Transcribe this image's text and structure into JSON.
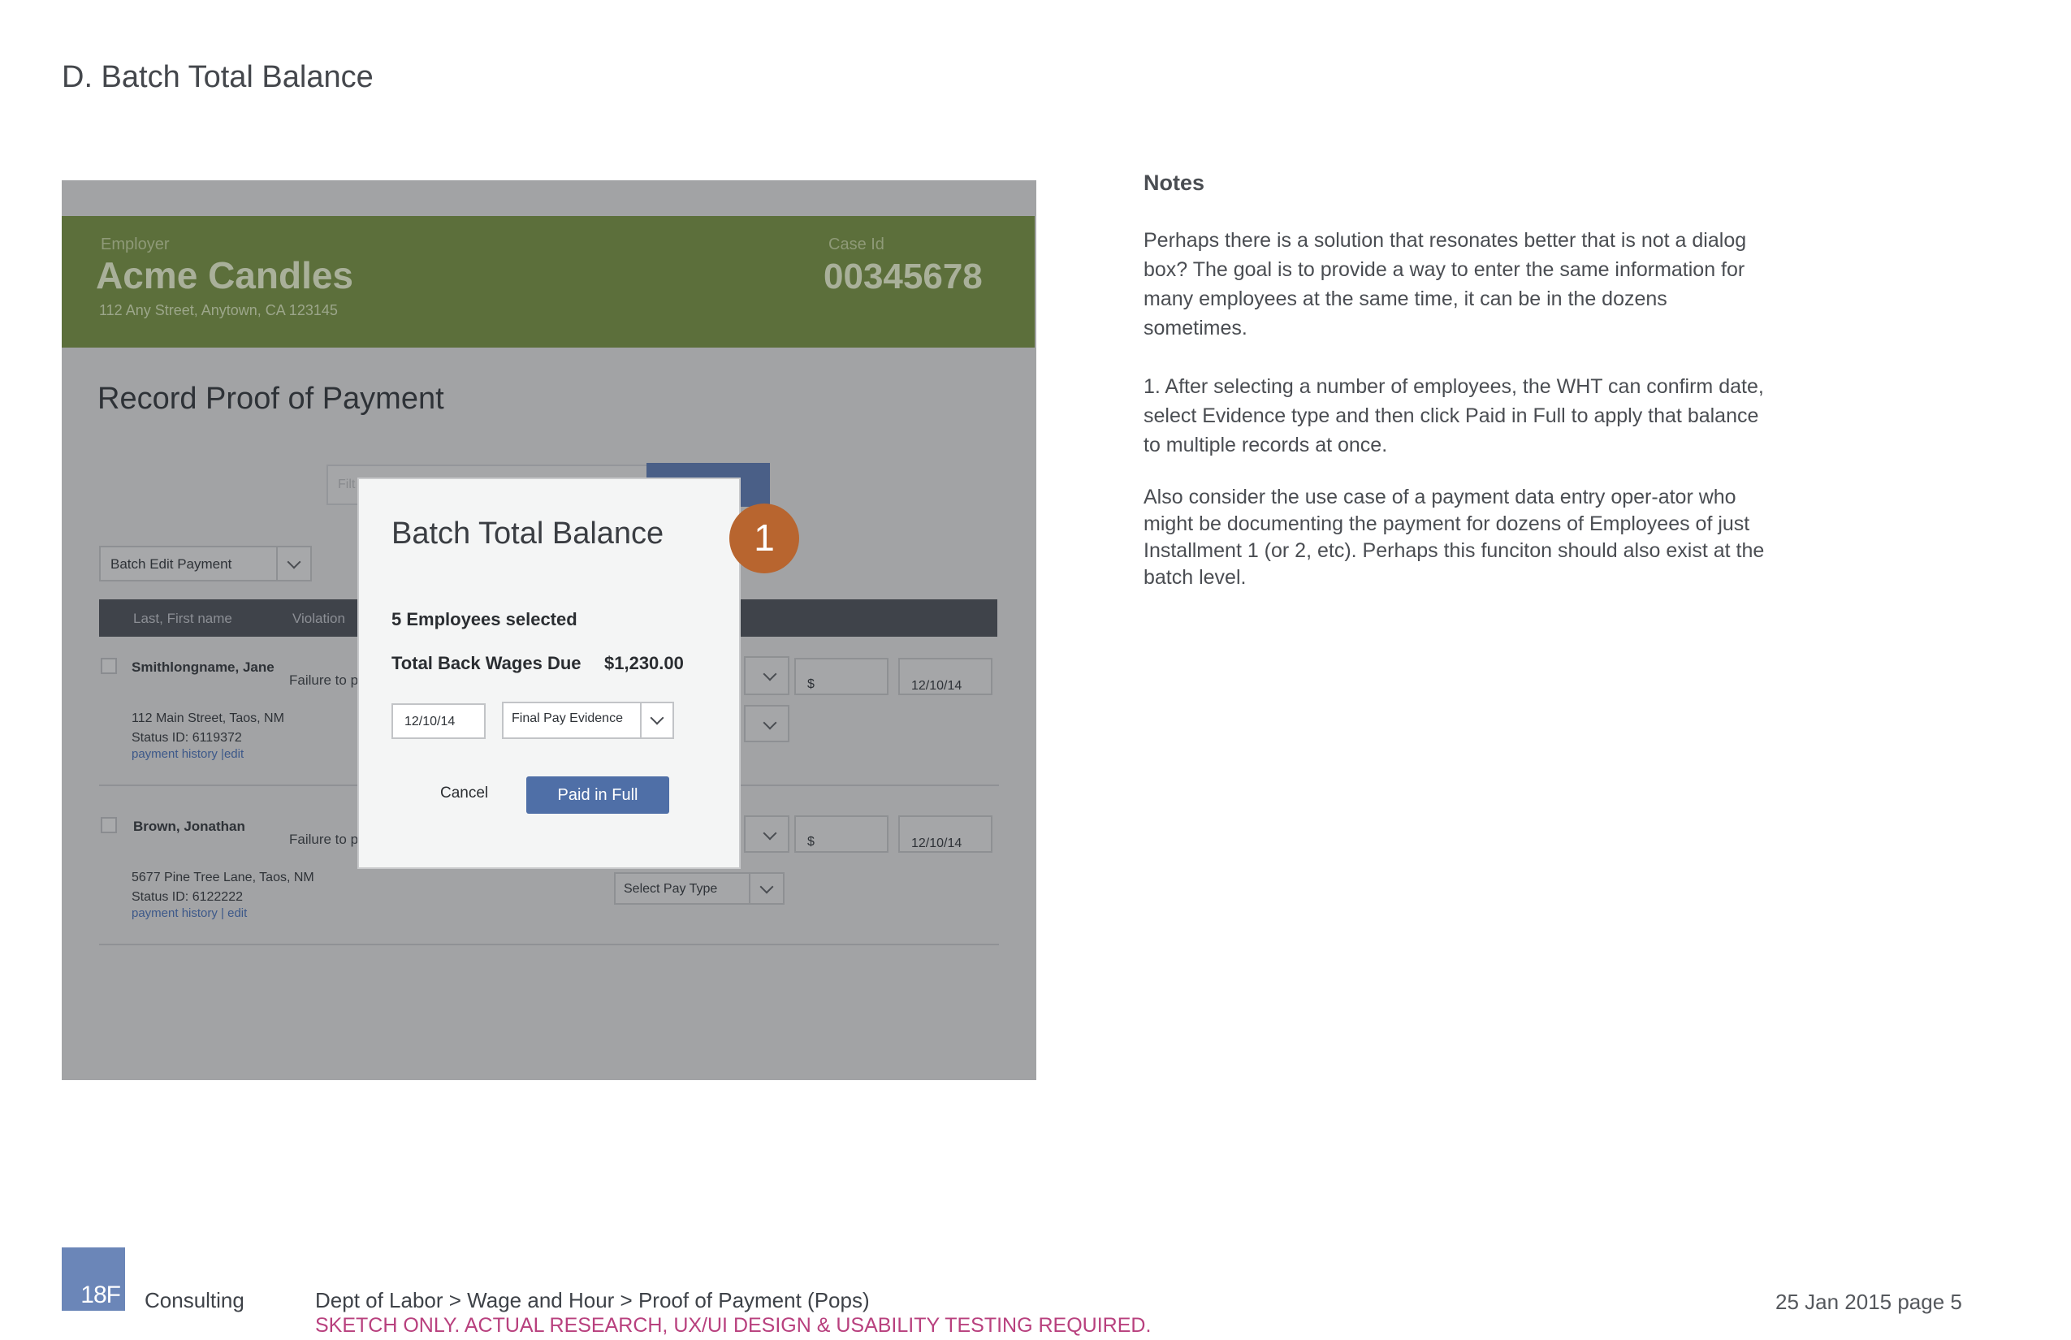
{
  "page": {
    "title": "D. Batch Total Balance"
  },
  "mockup": {
    "header": {
      "employer_label": "Employer",
      "employer_name": "Acme Candles",
      "employer_address": "112 Any Street, Anytown, CA  123145",
      "case_label": "Case Id",
      "case_id": "00345678"
    },
    "title": "Record Proof of Payment",
    "filter_placeholder": "Filt",
    "batch_select": "Batch Edit Payment",
    "table_headers": [
      "Last, First name",
      "Violation"
    ],
    "rows": [
      {
        "name": "Smithlongname, Jane",
        "violation": "Failure to p",
        "address": "112 Main Street, Taos, NM",
        "status": "Status ID: 6119372",
        "links": "payment history  |edit",
        "amount_prefix": "$",
        "date": "12/10/14"
      },
      {
        "name": "Brown, Jonathan",
        "violation": "Failure to p",
        "address": "5677 Pine Tree Lane, Taos, NM",
        "status": "Status ID: 6122222",
        "links": "payment history  |  edit",
        "amount_prefix": "$",
        "date": "12/10/14",
        "pay_type": "Select Pay Type"
      }
    ]
  },
  "dialog": {
    "title": "Batch Total Balance",
    "employees_selected": "5  Employees selected",
    "total_label": "Total Back Wages Due",
    "total_value": "$1,230.00",
    "date": "12/10/14",
    "evidence_type": "Final Pay Evidence",
    "cancel_label": "Cancel",
    "paid_label": "Paid in Full"
  },
  "badge": "1",
  "notes": {
    "heading": "Notes",
    "p1": "Perhaps there is a solution that resonates better that is not a dialog box?  The goal is to provide a way to enter the same information for many employees at the same time, it can be in the dozens sometimes.",
    "p2": "1.  After selecting a number of employees, the WHT can confirm date, select Evidence type and then click Paid in Full to apply that balance to multiple records at once.",
    "p3": "Also consider the use case of a payment data entry oper-ator who might be documenting the payment for dozens of Employees of just Installment 1 (or 2, etc). Perhaps this funciton should also exist at the batch level."
  },
  "footer": {
    "logo_text": "18F",
    "consulting": "Consulting",
    "breadcrumb": "Dept of Labor > Wage and Hour > Proof of Payment (Pops)",
    "disclaimer": "SKETCH ONLY. ACTUAL RESEARCH, UX/UI DESIGN & USABILITY TESTING REQUIRED.",
    "date_page": "25 Jan 2015  page 5"
  },
  "colors": {
    "header_green": "#5c6f3b",
    "primary_button": "#4f6fa7",
    "badge": "#b8652f",
    "disclaimer": "#b8407e",
    "logo": "#6b86b8"
  }
}
